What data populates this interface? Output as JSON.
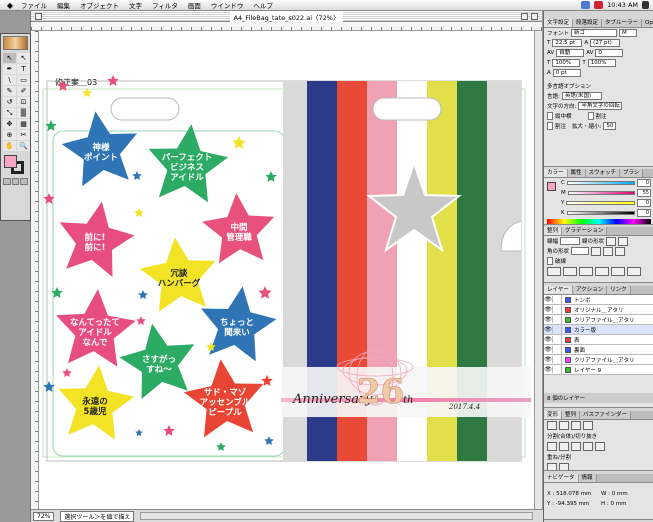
{
  "menubar": {
    "items": [
      "ファイル",
      "編集",
      "オブジェクト",
      "文字",
      "フィルタ",
      "画面",
      "ウインドウ",
      "ヘルプ"
    ],
    "clock": "10:43 AM"
  },
  "document": {
    "title": "A4_FileBag_tate_s022.ai〈72%〉",
    "artboard_label": "修正案＿03",
    "zoom": "72%",
    "status": "選択ツール＞を値で描え"
  },
  "artwork": {
    "stars": [
      {
        "text": "神様\nポイント",
        "color": "#2f74b5"
      },
      {
        "text": "パーフェクト\nビジネス\nアイドル",
        "color": "#2bab63"
      },
      {
        "text": "中間\n管理職",
        "color": "#e8527a"
      },
      {
        "text": "前に!\n前に!",
        "color": "#e84d82"
      },
      {
        "text": "冗談\nハンバーグ",
        "color": "#f2e326"
      },
      {
        "text": "なんてったて\nアイドル\nなんで",
        "color": "#e84d82"
      },
      {
        "text": "ちょっと\n聞来い",
        "color": "#2f74b5"
      },
      {
        "text": "さすがっ\nすね～",
        "color": "#2bab63"
      },
      {
        "text": "永遠の\n5歳児",
        "color": "#f2e326"
      },
      {
        "text": "サド・マゾ\nアッセンブル\nピープル",
        "color": "#e84534"
      }
    ],
    "stripe_colors": [
      "#2c3a8a",
      "#e94a36",
      "#f0a2b4",
      "#ffffff",
      "#e3df4a",
      "#2f7a43"
    ],
    "anniversary_text": "Anniversary",
    "number": "26",
    "number_suffix": "th",
    "date": "2017.4.4"
  },
  "toolbox": {
    "tools": [
      "↖",
      "↖",
      "✒",
      "T",
      "\\",
      "▭",
      "✎",
      "✐",
      "↺",
      "⊡",
      "⤡",
      "▒",
      "✥",
      "▦",
      "⊕",
      "✂",
      "✋",
      "🔍"
    ],
    "fill_color": "#f4a6c4"
  },
  "character_panel": {
    "tabs": [
      "文字設定",
      "段落設定",
      "タブルーラー",
      "OpenTypeフォント設定"
    ],
    "font_label": "フォント",
    "font_value": "新ゴ",
    "font_style": "M",
    "font_size": "22.5 pt",
    "leading": "(27 pt)",
    "tracking": "自動",
    "kerning": "0",
    "hscale": "100%",
    "vscale": "100%",
    "baseline": "0 pt",
    "opt_title": "多言語オプション",
    "language_label": "言語:",
    "language_value": "英語(米国)",
    "direction_label": "文字の方向:",
    "direction_value": "半角文字の回転",
    "opt1": "縦中横",
    "opt2": "割注",
    "opt3": "割注",
    "scale_label": "拡大・縮小:",
    "scale_value": "50"
  },
  "color_panel": {
    "tabs": [
      "カラー",
      "属性",
      "スウォッチ",
      "ブラシ"
    ],
    "channels": [
      {
        "label": "C",
        "value": "0"
      },
      {
        "label": "M",
        "value": "55"
      },
      {
        "label": "Y",
        "value": "0"
      },
      {
        "label": "K",
        "value": "0"
      }
    ]
  },
  "align_panel": {
    "tabs": [
      "整列",
      "グラデーション"
    ],
    "label1": "線幅",
    "label2": "線の形状",
    "label3": "角の形状",
    "label4": "破線"
  },
  "layers_panel": {
    "tabs": [
      "レイヤー",
      "アクション",
      "リンク"
    ],
    "layers": [
      {
        "name": "トンボ",
        "color": "#3b5bff"
      },
      {
        "name": "オリジナル＿アタリ",
        "color": "#ff3b3b"
      },
      {
        "name": "クリアファイル＿アタリ",
        "color": "#3bbf3b"
      },
      {
        "name": "カラー版",
        "color": "#3b5bff"
      },
      {
        "name": "表",
        "color": "#ff3b3b"
      },
      {
        "name": "裏面",
        "color": "#3b5bff"
      },
      {
        "name": "クリアファイル＿アタリ",
        "color": "#ff3bff"
      },
      {
        "name": "レイヤー 9",
        "color": "#3bbf3b"
      }
    ],
    "footer": "8 個のレイヤー"
  },
  "transform_panel": {
    "tabs": [
      "変形",
      "整列",
      "パスファインダー"
    ],
    "label1": "分割(合体)/切り抜き",
    "label2": "合成(分割)",
    "label3": "重ね/分割"
  },
  "info_panel": {
    "tabs": [
      "ナビゲータ",
      "情報"
    ],
    "x": "X : 518.078 mm",
    "y": "Y : -94.395 mm",
    "w": "W : 0 mm",
    "h": "H : 0 mm"
  }
}
